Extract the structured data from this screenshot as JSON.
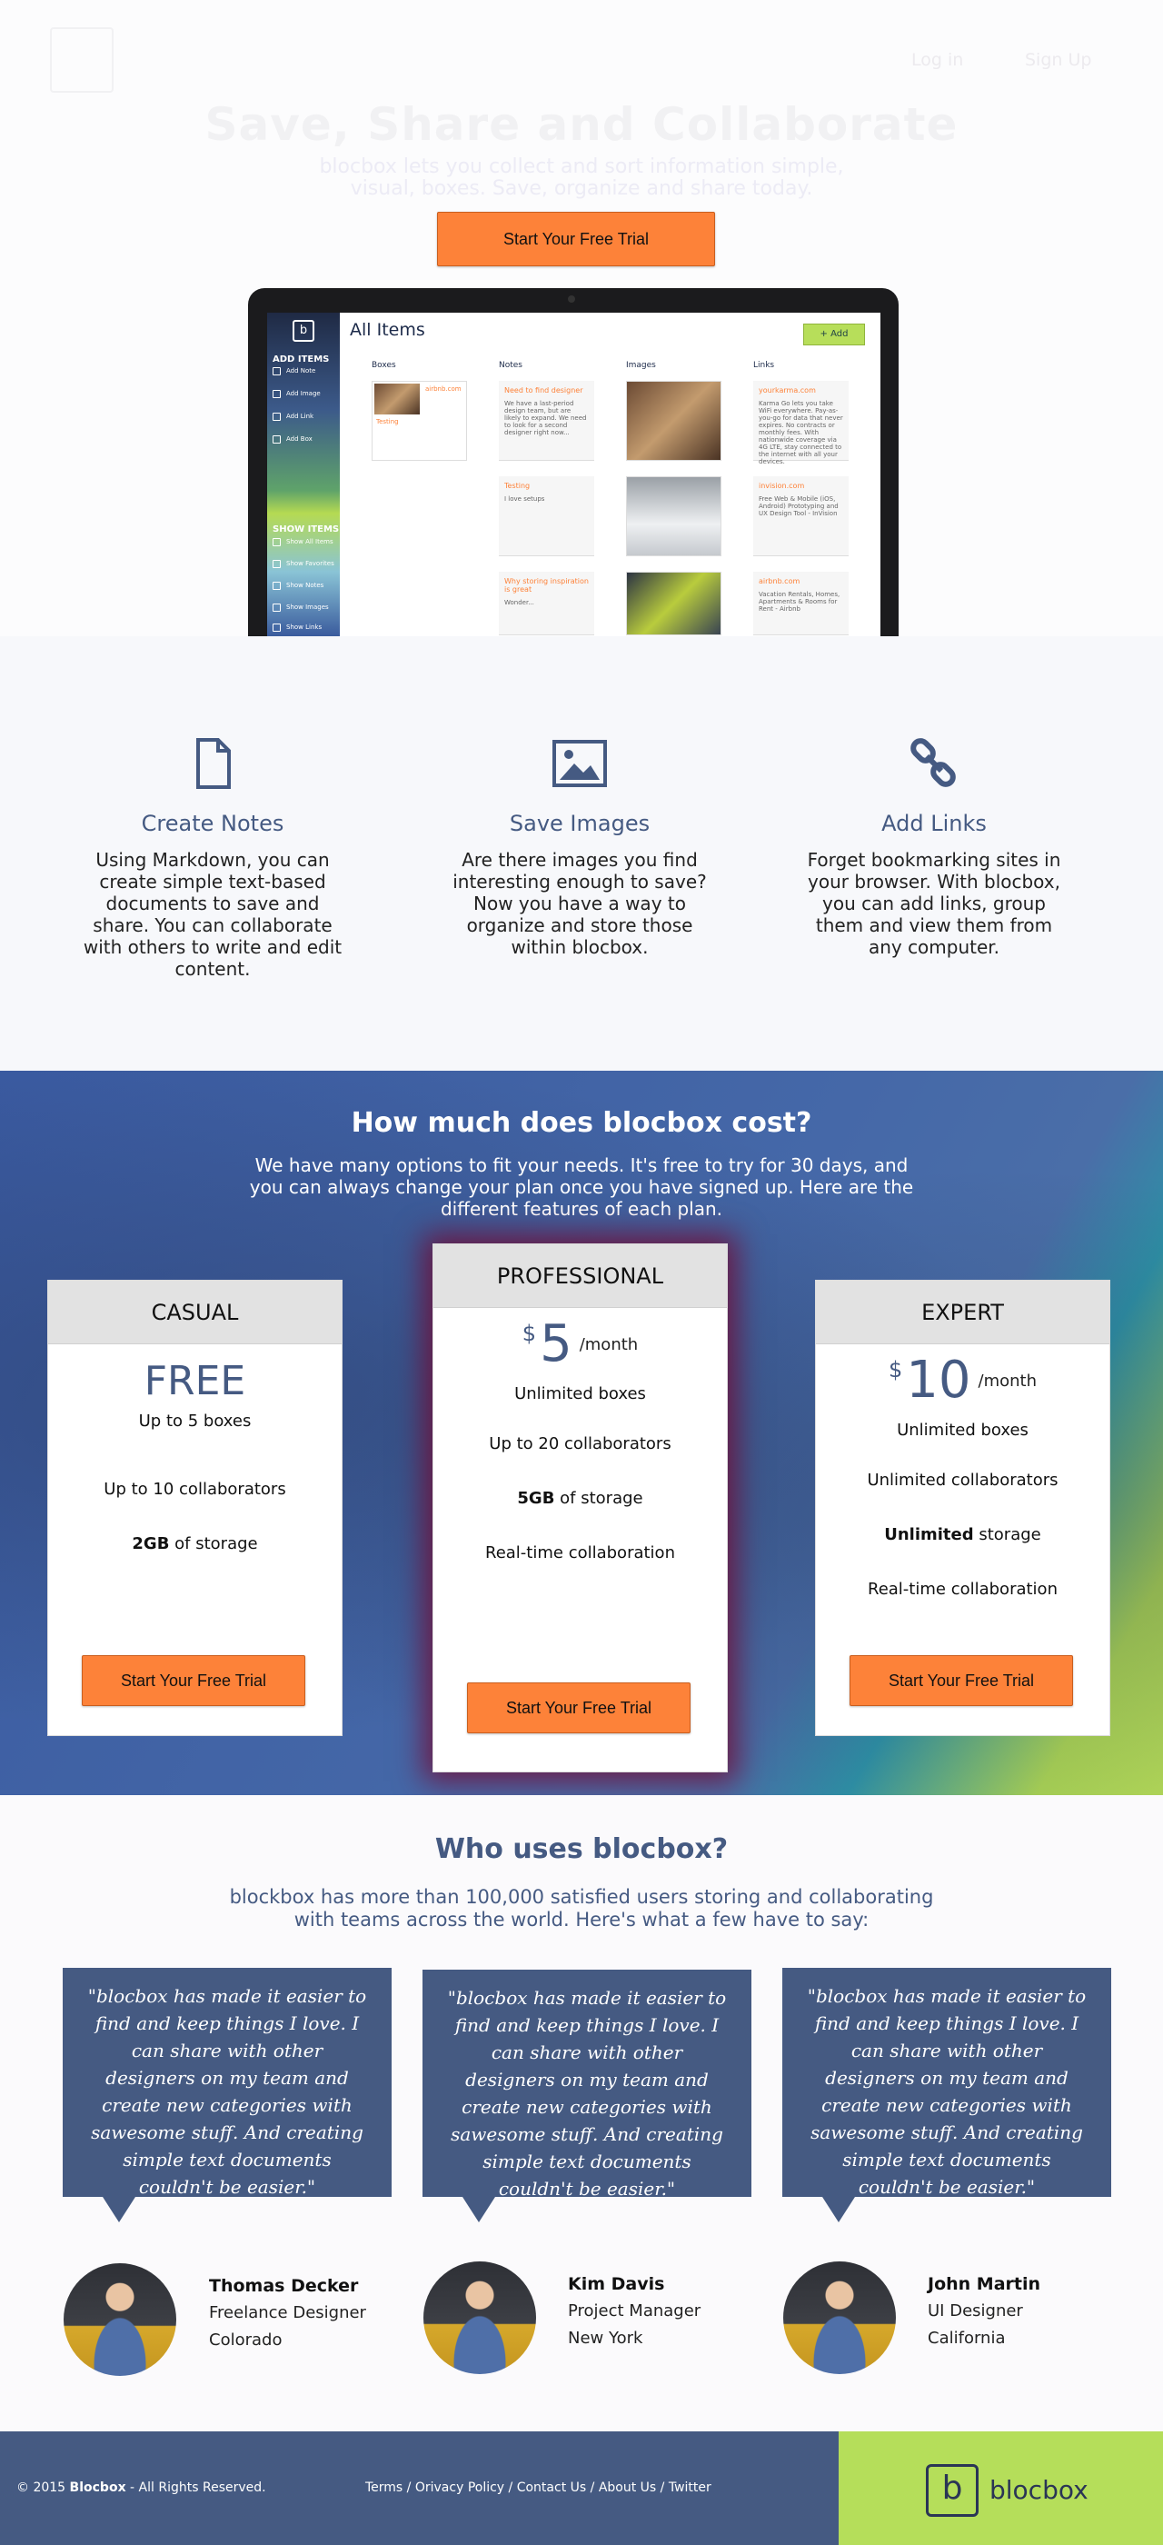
{
  "nav": {
    "login": "Log in",
    "signup": "Sign Up"
  },
  "hero": {
    "title": "Save, Share and Collaborate",
    "subtitle": "blocbox lets you collect and sort information simple, visual, boxes. Save, organize and share today.",
    "cta": "Start Your Free Trial"
  },
  "app_preview": {
    "title": "All Items",
    "add_button": "+ Add",
    "add_items_heading": "ADD ITEMS",
    "add_items": [
      "Add Note",
      "Add Image",
      "Add Link",
      "Add Box"
    ],
    "show_items_heading": "SHOW ITEMS",
    "show_items": [
      "Show All Items",
      "Show Favorites",
      "Show Notes",
      "Show Images",
      "Show Links"
    ],
    "columns": [
      "Boxes",
      "Notes",
      "Images",
      "Links"
    ],
    "box_card": {
      "label": "airbnb.com",
      "caption": "Testing"
    },
    "notes": [
      {
        "title": "Need to find designer",
        "body": "We have a last-period design team, but are likely to expand. We need to look for a second designer right now..."
      },
      {
        "title": "Testing",
        "body": "I love setups"
      },
      {
        "title": "Why storing inspiration is great",
        "body": "Wonder..."
      }
    ],
    "links": [
      {
        "title": "yourkarma.com",
        "body": "Karma Go lets you take WiFi everywhere. Pay-as-you-go for data that never expires. No contracts or monthly fees. With nationwide coverage via 4G LTE, stay connected to the internet with all your devices."
      },
      {
        "title": "invision.com",
        "body": "Free Web & Mobile (iOS, Android) Prototyping and UX Design Tool - InVision"
      },
      {
        "title": "airbnb.com",
        "body": "Vacation Rentals, Homes, Apartments & Rooms for Rent - Airbnb"
      }
    ]
  },
  "features": [
    {
      "icon": "document-icon",
      "title": "Create Notes",
      "text": "Using Markdown, you can create simple text-based documents to save and share.  You can collaborate with others to write and edit content."
    },
    {
      "icon": "image-icon",
      "title": "Save Images",
      "text": "Are there images you find interesting enough to save?  Now you have a way to organize and store those within blocbox."
    },
    {
      "icon": "link-icon",
      "title": "Add Links",
      "text": "Forget bookmarking sites in your browser.  With blocbox, you can add links, group them and view them from any computer."
    }
  ],
  "pricing": {
    "title": "How much does blocbox cost?",
    "subtitle": "We have many options to fit your needs.  It's free to try for 30 days, and you can always change your plan once you have signed up.  Here are the different features of each plan.",
    "plans": [
      {
        "name": "CASUAL",
        "price": "FREE",
        "features": [
          {
            "pre": "Up to 5 boxes",
            "bold": "",
            "post": ""
          },
          {
            "pre": "Up to 10 collaborators",
            "bold": "",
            "post": ""
          },
          {
            "pre": "",
            "bold": "2GB",
            "post": " of storage"
          }
        ],
        "cta": "Start Your Free Trial"
      },
      {
        "name": "PROFESSIONAL",
        "currency": "$",
        "amount": "5",
        "period": "/month",
        "features": [
          {
            "pre": "Unlimited boxes",
            "bold": "",
            "post": ""
          },
          {
            "pre": "Up to 20 collaborators",
            "bold": "",
            "post": ""
          },
          {
            "pre": "",
            "bold": "5GB",
            "post": " of storage"
          },
          {
            "pre": "Real-time collaboration",
            "bold": "",
            "post": ""
          }
        ],
        "cta": "Start Your Free Trial"
      },
      {
        "name": "EXPERT",
        "currency": "$",
        "amount": "10",
        "period": "/month",
        "features": [
          {
            "pre": "Unlimited boxes",
            "bold": "",
            "post": ""
          },
          {
            "pre": "Unlimited collaborators",
            "bold": "",
            "post": ""
          },
          {
            "pre": "",
            "bold": "Unlimited",
            "post": " storage"
          },
          {
            "pre": "Real-time collaboration",
            "bold": "",
            "post": ""
          }
        ],
        "cta": "Start Your Free Trial"
      }
    ]
  },
  "testimonials": {
    "title": "Who uses blocbox?",
    "subtitle": "blockbox has more than 100,000 satisfied users storing and collaborating with teams across the world.  Here's what a few have to say:",
    "items": [
      {
        "quote": "\"blocbox has made it easier to find and keep things I love.  I can share with other designers on my team and create new categories with sawesome stuff.  And creating simple text documents couldn't be easier.\"",
        "name": "Thomas Decker",
        "role": "Freelance Designer",
        "location": "Colorado"
      },
      {
        "quote": "\"blocbox has made it easier to find and keep things I love.  I can share with other designers on my team and create new categories with sawesome stuff.  And creating simple text documents couldn't be easier.\"",
        "name": "Kim Davis",
        "role": "Project Manager",
        "location": "New York"
      },
      {
        "quote": "\"blocbox has made it easier to find and keep things I love.  I can share with other designers on my team and create new categories with sawesome stuff.  And creating simple text documents couldn't be easier.\"",
        "name": "John Martin",
        "role": "UI Designer",
        "location": "California"
      }
    ]
  },
  "footer": {
    "copyright_prefix": "©  2015",
    "copyright_brand": "Blocbox",
    "copyright_suffix": " - All Rights Reserved.",
    "links": [
      "Terms",
      "Orivacy Policy",
      "Contact Us",
      "About Us",
      "Twitter"
    ],
    "link_separator": " / ",
    "brand_mark": "b",
    "brand_name": "blocbox"
  },
  "colors": {
    "accent": "#fd8239",
    "brand_blue": "#455a82",
    "brand_green": "#b5de5a"
  }
}
